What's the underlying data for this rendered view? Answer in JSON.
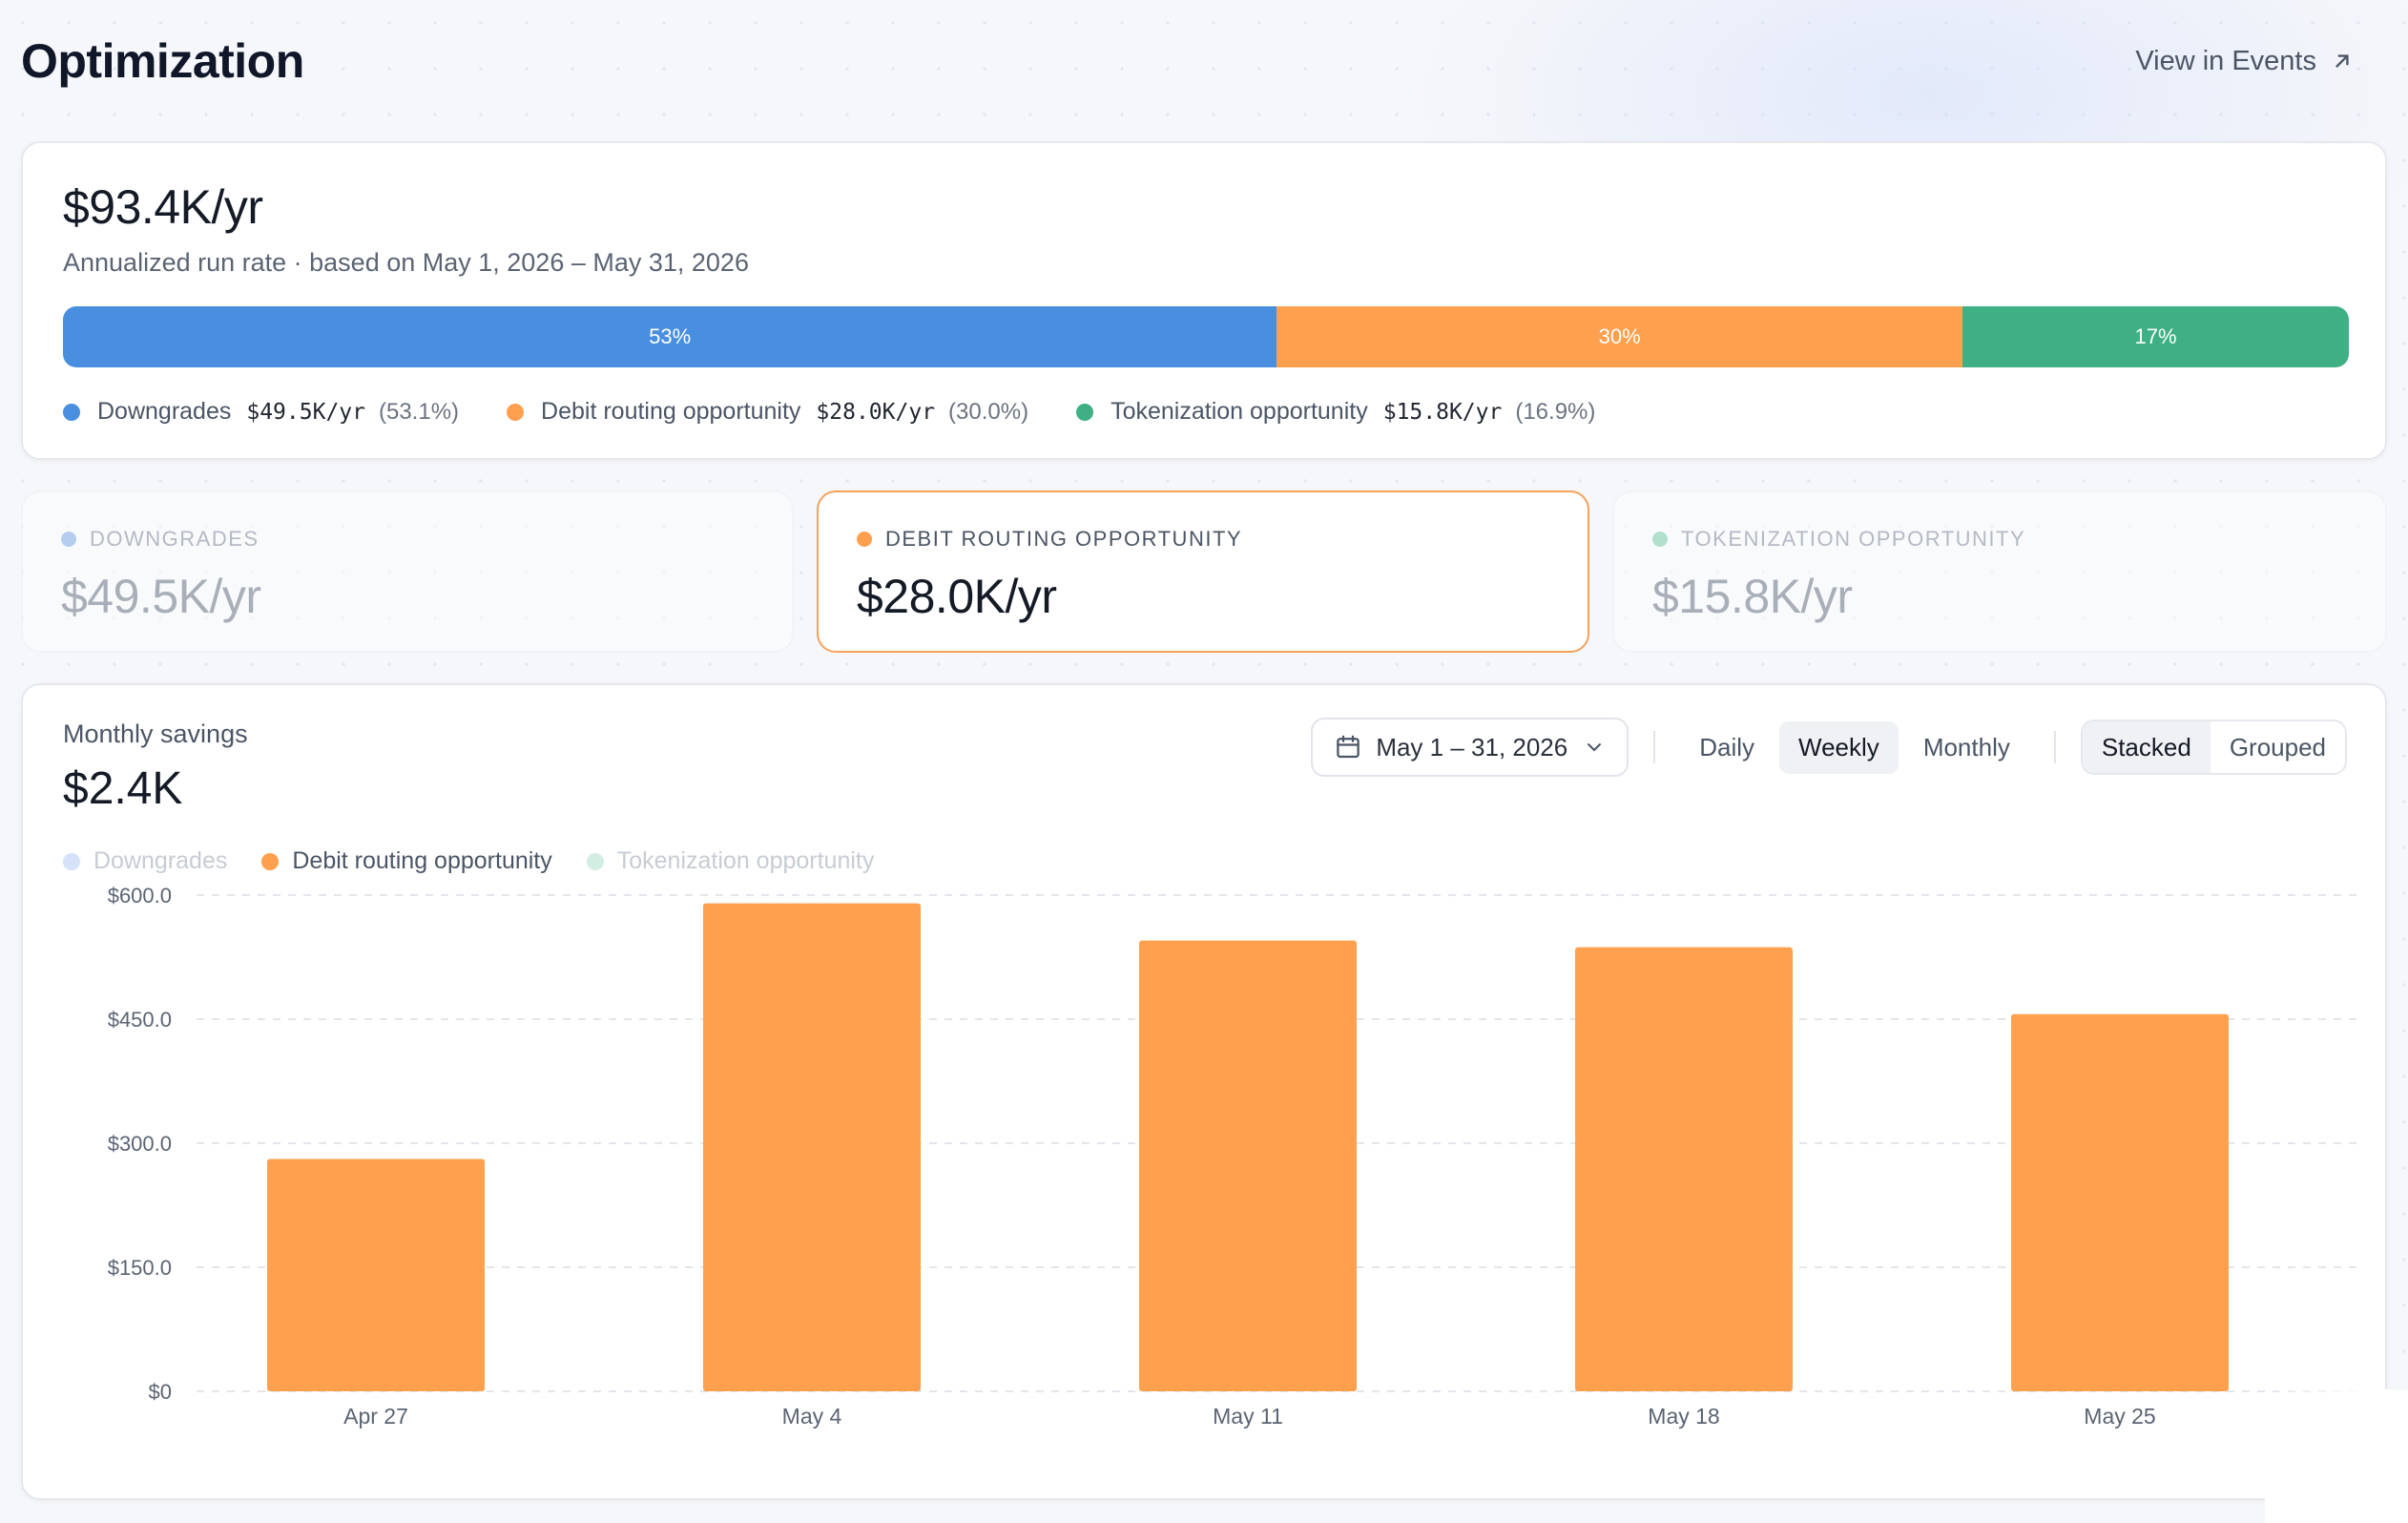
{
  "header": {
    "title": "Optimization",
    "view_events_label": "View in Events"
  },
  "summary": {
    "value": "$93.4K/yr",
    "subtitle": "Annualized run rate · based on May 1, 2026 – May 31, 2026",
    "segments": [
      {
        "label": "53%",
        "share": 0.531,
        "color": "#4a8ee0"
      },
      {
        "label": "30%",
        "share": 0.3,
        "color": "#ffa04e"
      },
      {
        "label": "17%",
        "share": 0.169,
        "color": "#3eb083"
      }
    ],
    "legend": [
      {
        "name": "Downgrades",
        "amount": "$49.5K/yr",
        "pct": "(53.1%)",
        "color": "#4a8ee0"
      },
      {
        "name": "Debit routing opportunity",
        "amount": "$28.0K/yr",
        "pct": "(30.0%)",
        "color": "#ffa04e"
      },
      {
        "name": "Tokenization opportunity",
        "amount": "$15.8K/yr",
        "pct": "(16.9%)",
        "color": "#3eb083"
      }
    ]
  },
  "categories": [
    {
      "label": "DOWNGRADES",
      "value": "$49.5K/yr",
      "color": "#b7cdf0",
      "active": false
    },
    {
      "label": "DEBIT ROUTING OPPORTUNITY",
      "value": "$28.0K/yr",
      "color": "#ffa04e",
      "active": true
    },
    {
      "label": "TOKENIZATION OPPORTUNITY",
      "value": "$15.8K/yr",
      "color": "#b3e0cd",
      "active": false
    }
  ],
  "monthly": {
    "title": "Monthly savings",
    "value": "$2.4K",
    "date_range": "May 1 – 31, 2026",
    "periods": [
      "Daily",
      "Weekly",
      "Monthly"
    ],
    "selected_period": "Weekly",
    "modes": [
      "Stacked",
      "Grouped"
    ],
    "selected_mode": "Stacked",
    "legend": [
      {
        "name": "Downgrades",
        "color": "#d6e2f7",
        "active": false
      },
      {
        "name": "Debit routing opportunity",
        "color": "#ffa04e",
        "active": true
      },
      {
        "name": "Tokenization opportunity",
        "color": "#d2ede2",
        "active": false
      }
    ]
  },
  "chart_data": {
    "type": "bar",
    "categories": [
      "Apr 27",
      "May 4",
      "May 11",
      "May 18",
      "May 25"
    ],
    "series": [
      {
        "name": "Debit routing opportunity",
        "values": [
          281,
          590,
          545,
          537,
          456
        ],
        "color": "#ffa04e"
      }
    ],
    "yticks": [
      0,
      150,
      300,
      450,
      600
    ],
    "ytick_labels": [
      "$0",
      "$150.0",
      "$300.0",
      "$450.0",
      "$600.0"
    ],
    "ylim": [
      0,
      600
    ],
    "grid": true,
    "title": "",
    "xlabel": "",
    "ylabel": ""
  }
}
